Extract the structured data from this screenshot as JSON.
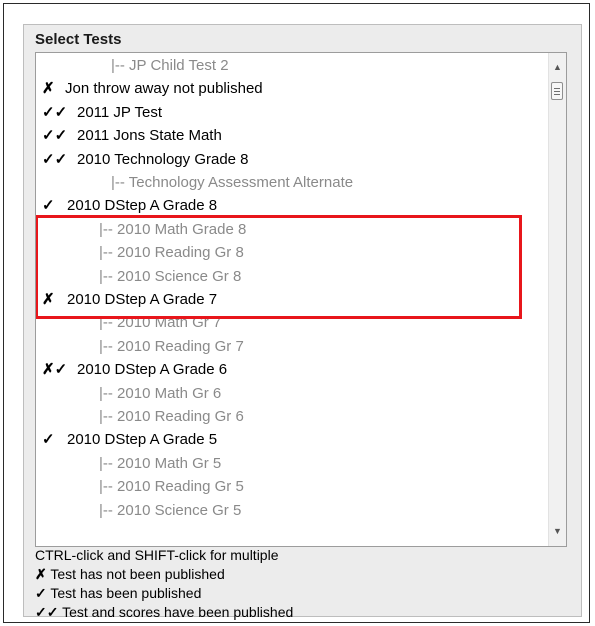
{
  "title": "Select Tests",
  "rows": [
    {
      "mark": "",
      "label": "|-- JP Child Test 2",
      "kind": "child"
    },
    {
      "mark": "✗",
      "label": "Jon throw away not published",
      "kind": "parent"
    },
    {
      "mark": "✓✓",
      "label": "2011 JP Test",
      "kind": "parent"
    },
    {
      "mark": "✓✓",
      "label": "2011 Jons State Math",
      "kind": "parent"
    },
    {
      "mark": "✓✓",
      "label": "2010 Technology Grade 8",
      "kind": "parent"
    },
    {
      "mark": "",
      "label": "|-- Technology Assessment Alternate",
      "kind": "child"
    },
    {
      "mark": "✓",
      "label": "2010 DStep A Grade 8",
      "kind": "parent"
    },
    {
      "mark": "",
      "label": "|-- 2010 Math Grade 8",
      "kind": "child"
    },
    {
      "mark": "",
      "label": "|-- 2010 Reading Gr 8",
      "kind": "child"
    },
    {
      "mark": "",
      "label": "|-- 2010 Science Gr 8",
      "kind": "child"
    },
    {
      "mark": "✗",
      "label": "2010 DStep A Grade 7",
      "kind": "parent"
    },
    {
      "mark": "",
      "label": "|-- 2010 Math Gr 7",
      "kind": "child"
    },
    {
      "mark": "",
      "label": "|-- 2010 Reading Gr 7",
      "kind": "child"
    },
    {
      "mark": "✗✓",
      "label": "2010 DStep A Grade 6",
      "kind": "parent"
    },
    {
      "mark": "",
      "label": "|-- 2010 Math Gr 6",
      "kind": "child"
    },
    {
      "mark": "",
      "label": "|-- 2010 Reading Gr 6",
      "kind": "child"
    },
    {
      "mark": "✓",
      "label": "2010 DStep A Grade 5",
      "kind": "parent"
    },
    {
      "mark": "",
      "label": "|-- 2010 Math Gr 5",
      "kind": "child"
    },
    {
      "mark": "",
      "label": "|-- 2010 Reading Gr 5",
      "kind": "child"
    },
    {
      "mark": "",
      "label": "|-- 2010 Science Gr 5",
      "kind": "child"
    }
  ],
  "legend": {
    "instruction": "CTRL-click and SHIFT-click for multiple",
    "items": [
      {
        "mark": "✗",
        "text": "Test has not been published"
      },
      {
        "mark": "✓",
        "text": "Test has been published"
      },
      {
        "mark": "✓✓",
        "text": "Test and scores have been published"
      }
    ]
  },
  "colors": {
    "highlight": "#e8161b",
    "child_text": "#8a8a8a",
    "parent_text": "#000000"
  },
  "icons": {
    "scroll_up": "triangle-up-icon",
    "scroll_down": "triangle-down-icon",
    "not_published": "cross-icon",
    "published": "check-icon",
    "scores_published": "double-check-icon"
  }
}
